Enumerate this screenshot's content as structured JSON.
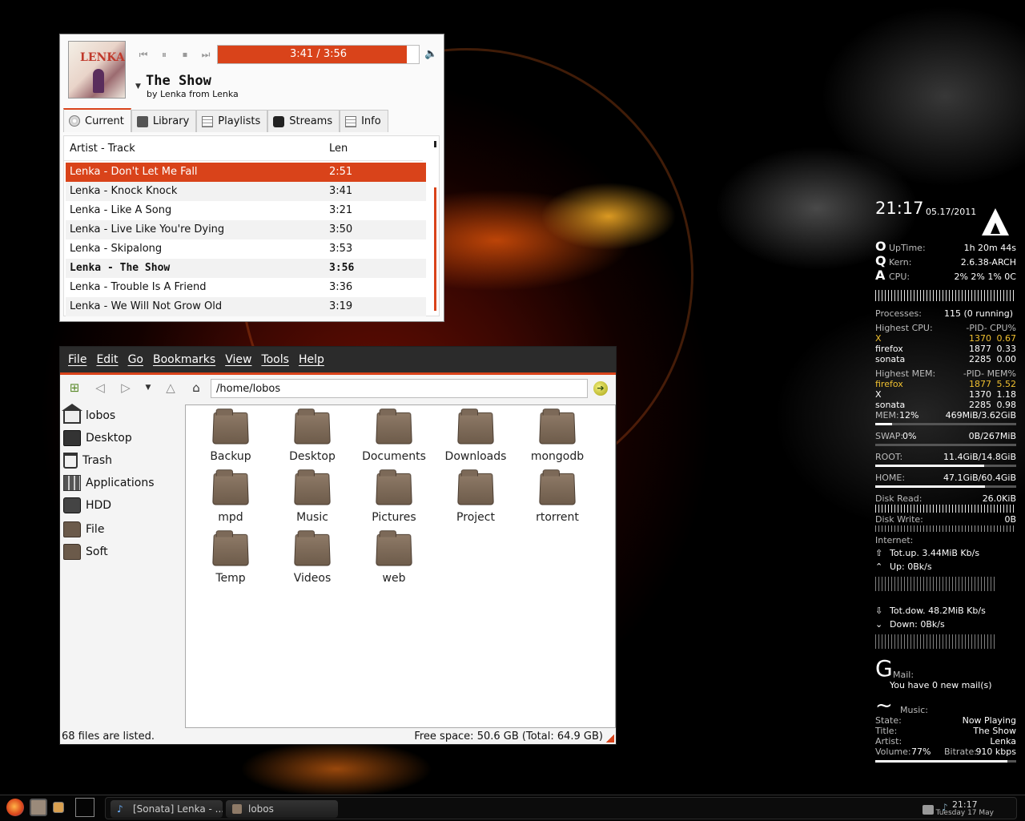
{
  "sonata": {
    "elapsed": "3:41 / 3:56",
    "progress_fraction": 0.94,
    "song_title": "The Show",
    "song_subtitle": "by Lenka from Lenka",
    "album_art_text": "LENKA",
    "tabs": [
      {
        "label": "Current",
        "icon": "disc-icon"
      },
      {
        "label": "Library",
        "icon": "library-icon"
      },
      {
        "label": "Playlists",
        "icon": "playlist-icon"
      },
      {
        "label": "Streams",
        "icon": "streams-icon"
      },
      {
        "label": "Info",
        "icon": "info-icon"
      }
    ],
    "columns": {
      "track": "Artist - Track",
      "length": "Len"
    },
    "rows": [
      {
        "track": "Lenka - Don't Let Me Fall",
        "len": "2:51"
      },
      {
        "track": "Lenka - Knock Knock",
        "len": "3:41"
      },
      {
        "track": "Lenka - Like A Song",
        "len": "3:21"
      },
      {
        "track": "Lenka - Live Like You're Dying",
        "len": "3:50"
      },
      {
        "track": "Lenka - Skipalong",
        "len": "3:53"
      },
      {
        "track": "Lenka - The Show",
        "len": "3:56"
      },
      {
        "track": "Lenka - Trouble Is A Friend",
        "len": "3:36"
      },
      {
        "track": "Lenka - We Will Not Grow Old",
        "len": "3:19"
      }
    ],
    "accent": "#d9431a"
  },
  "filemanager": {
    "menu": [
      "File",
      "Edit",
      "Go",
      "Bookmarks",
      "View",
      "Tools",
      "Help"
    ],
    "path": "/home/lobos",
    "places": [
      {
        "label": "lobos",
        "icon": "home-icon"
      },
      {
        "label": "Desktop",
        "icon": "desktop-icon"
      },
      {
        "label": "Trash",
        "icon": "trash-icon"
      },
      {
        "label": "Applications",
        "icon": "applications-icon"
      },
      {
        "label": "HDD",
        "icon": "hdd-icon"
      },
      {
        "label": "File",
        "icon": "folder-icon"
      },
      {
        "label": "Soft",
        "icon": "folder-icon"
      }
    ],
    "folders": [
      "Backup",
      "Desktop",
      "Documents",
      "Downloads",
      "mongodb",
      "mpd",
      "Music",
      "Pictures",
      "Project",
      "rtorrent",
      "Temp",
      "Videos",
      "web"
    ],
    "status_left": "68 files are listed.",
    "status_right": "Free space: 50.6 GB (Total: 64.9 GB)"
  },
  "conky": {
    "time": "21:17",
    "date": "05.17/2011",
    "uptime_label": "UpTime:",
    "uptime": "1h 20m 44s",
    "kern_label": "Kern:",
    "kern": "2.6.38-ARCH",
    "cpu_label": "CPU:",
    "cpu": "2% 2% 1% 0C",
    "processes_label": "Processes:",
    "processes": "115  (0 running)",
    "cpu_top_header": "Highest CPU:",
    "cpu_top_cols": "-PID-  CPU%",
    "cpu_top": [
      {
        "name": "X",
        "pid": "1370",
        "val": "0.67"
      },
      {
        "name": "firefox",
        "pid": "1877",
        "val": "0.33"
      },
      {
        "name": "sonata",
        "pid": "2285",
        "val": "0.00"
      }
    ],
    "mem_top_header": "Highest MEM:",
    "mem_top_cols": "-PID-  MEM%",
    "mem_top": [
      {
        "name": "firefox",
        "pid": "1877",
        "val": "5.52"
      },
      {
        "name": "X",
        "pid": "1370",
        "val": "1.18"
      },
      {
        "name": "sonata",
        "pid": "2285",
        "val": "0.98"
      }
    ],
    "mem_label": "MEM:",
    "mem_pct": "12%",
    "mem": "469MiB/3.62GiB",
    "mem_fraction": 0.12,
    "swap_label": "SWAP:",
    "swap_pct": "0%",
    "swap": "0B/267MiB",
    "swap_fraction": 0.0,
    "root_label": "ROOT:",
    "root": "11.4GiB/14.8GiB",
    "root_fraction": 0.77,
    "home_label": "HOME:",
    "home": "47.1GiB/60.4GiB",
    "home_fraction": 0.78,
    "disk_read_label": "Disk Read:",
    "disk_read": "26.0KiB",
    "disk_write_label": "Disk Write:",
    "disk_write": "0B",
    "internet_label": "Internet:",
    "tot_up": "Tot.up. 3.44MiB Kb/s",
    "up": "Up: 0Bk/s",
    "tot_down": "Tot.dow. 48.2MiB Kb/s",
    "down": "Down: 0Bk/s",
    "mail_glyph": "G",
    "mail_label": "Mail:",
    "mail_text": "You have 0 new mail(s)",
    "music_glyph": "~",
    "music_label": "Music:",
    "state_label": "State:",
    "state": "Now Playing",
    "title_label": "Title:",
    "title": "The Show",
    "artist_label": "Artist:",
    "artist": "Lenka",
    "volume_label": "Volume:",
    "volume": "77%",
    "bitrate_label": "Bitrate:",
    "bitrate": "910 kbps",
    "music_fraction": 0.94,
    "glyph_o": "O",
    "glyph_q": "Q",
    "glyph_a": "A"
  },
  "taskbar": {
    "tasks": [
      "[Sonata] Lenka - ...",
      "lobos"
    ],
    "clock_time": "21:17",
    "clock_date": "Tuesday 17 May"
  }
}
